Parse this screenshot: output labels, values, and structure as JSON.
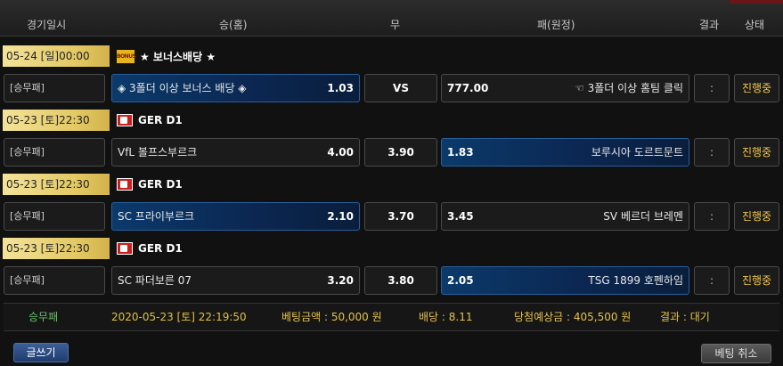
{
  "header": {
    "col_date": "경기일시",
    "col_home": "승(홈)",
    "col_draw": "무",
    "col_away": "패(원정)",
    "col_result": "결과",
    "col_status": "상태"
  },
  "games": [
    {
      "date": "05-24 [일]00:00",
      "league": "★ 보너스배당 ★",
      "league_icon": "bonus-icon",
      "bet_type": "[승무패]",
      "home_team": "◈ 3폴더 이상 보너스 배당 ◈",
      "home_odd": "1.03",
      "draw": "VS",
      "away_odd": "777.00",
      "away_team": "☜ 3폴더 이상 홈팀 클릭",
      "result": ":",
      "status": "진행중",
      "selected": "home"
    },
    {
      "date": "05-23 [토]22:30",
      "league": "GER D1",
      "league_icon": "germany-flag-icon",
      "bet_type": "[승무패]",
      "home_team": "VfL 볼프스부르크",
      "home_odd": "4.00",
      "draw": "3.90",
      "away_odd": "1.83",
      "away_team": "보루시아 도르트문트",
      "result": ":",
      "status": "진행중",
      "selected": "away"
    },
    {
      "date": "05-23 [토]22:30",
      "league": "GER D1",
      "league_icon": "germany-flag-icon",
      "bet_type": "[승무패]",
      "home_team": "SC 프라이부르크",
      "home_odd": "2.10",
      "draw": "3.70",
      "away_odd": "3.45",
      "away_team": "SV 베르더 브레멘",
      "result": ":",
      "status": "진행중",
      "selected": "home"
    },
    {
      "date": "05-23 [토]22:30",
      "league": "GER D1",
      "league_icon": "germany-flag-icon",
      "bet_type": "[승무패]",
      "home_team": "SC 파더보른 07",
      "home_odd": "3.20",
      "draw": "3.80",
      "away_odd": "2.05",
      "away_team": "TSG 1899 호펜하임",
      "result": ":",
      "status": "진행중",
      "selected": "away"
    }
  ],
  "summary": {
    "type": "승무패",
    "datetime": "2020-05-23 [토] 22:19:50",
    "bet_amount": "베팅금액 : 50,000 원",
    "odds": "배당 : 8.11",
    "expected": "당첨예상금 : 405,500 원",
    "result": "결과 : 대기"
  },
  "buttons": {
    "write": "글쓰기",
    "cancel": "베팅 취소"
  },
  "colors": {
    "date_badge": "#e2c862",
    "selected_odds": "#0b3a6b",
    "status_text": "#f2c84b",
    "summary_type": "#66c36a",
    "summary_datetime": "#e0c040",
    "summary_text": "#e6c34a"
  }
}
